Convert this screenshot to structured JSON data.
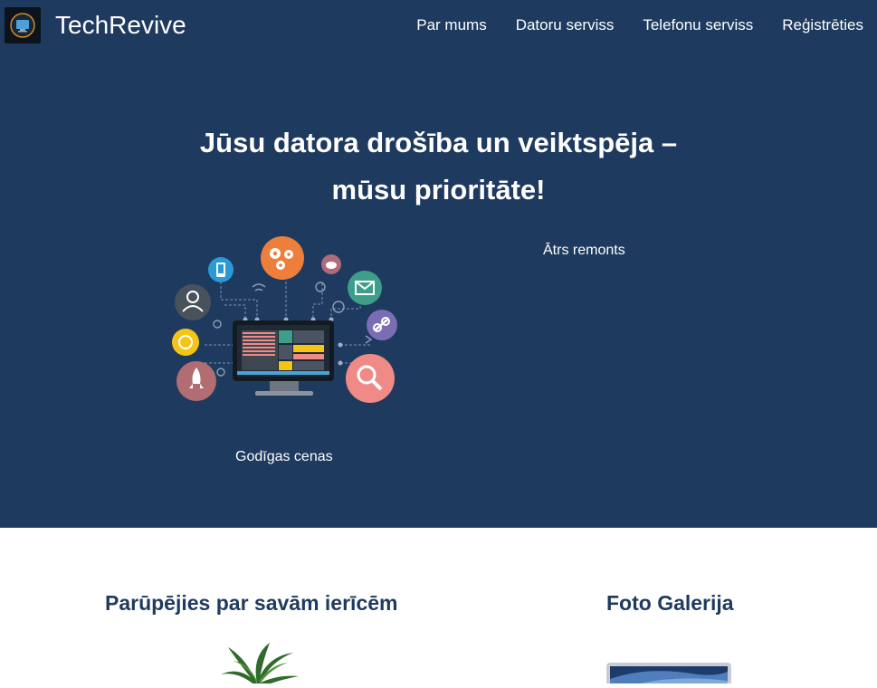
{
  "brand": {
    "name": "TechRevive",
    "logo_icon": "monitor-logo-icon"
  },
  "nav": {
    "items": [
      {
        "label": "Par mums"
      },
      {
        "label": "Datoru serviss"
      },
      {
        "label": "Telefonu serviss"
      },
      {
        "label": "Reģistrēties"
      }
    ]
  },
  "hero": {
    "title_line1": "Jūsu datora drošība un veiktspēja –",
    "title_line2": "mūsu prioritāte!",
    "feature_1": "Ātrs remonts",
    "feature_2": "Godīgas cenas"
  },
  "sections": {
    "care_title": "Parūpējies par savām ierīcēm",
    "gallery_title": "Foto Galerija"
  },
  "colors": {
    "nav_bg": "#1e3a5f",
    "hero_bg": "#1e3a5f",
    "heading": "#1f3a5f"
  }
}
